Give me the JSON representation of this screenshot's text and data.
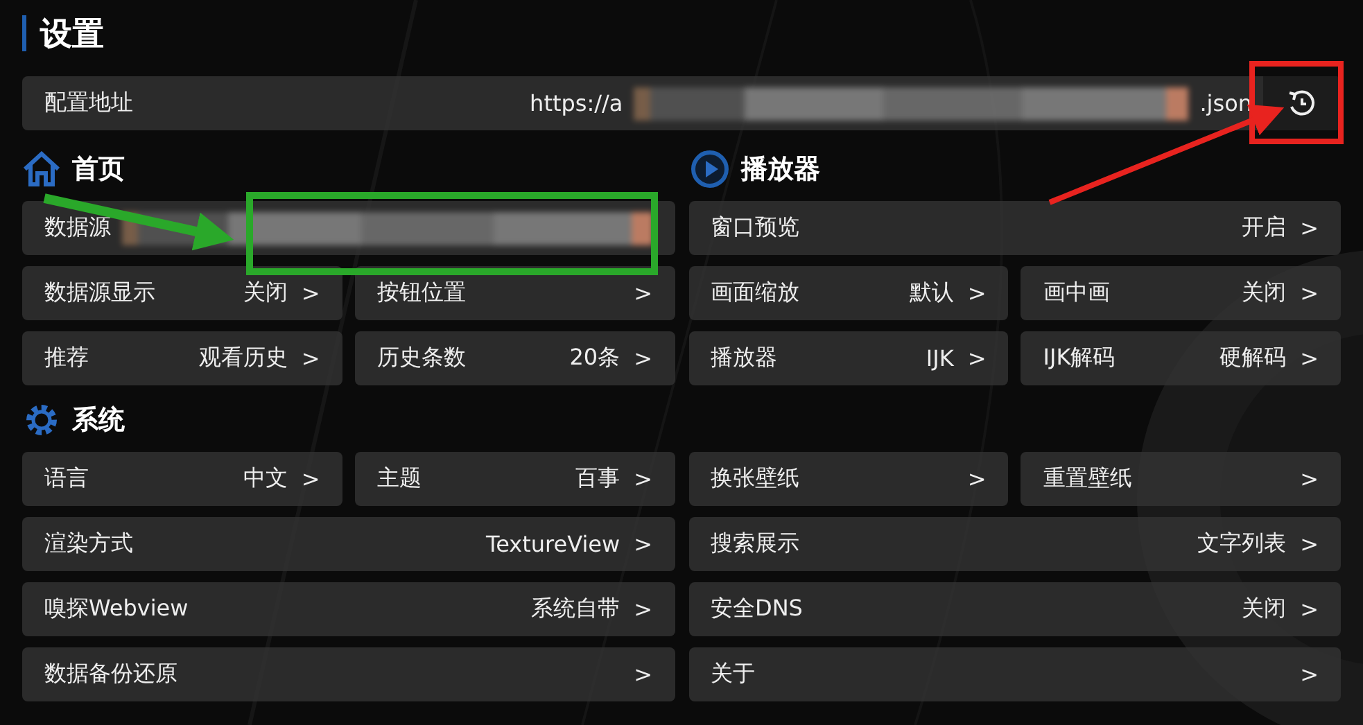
{
  "title": "设置",
  "config": {
    "label": "配置地址",
    "value_start": "https://a",
    "value_end": ".json"
  },
  "left_column": [
    {
      "title": "首页",
      "kind": "home",
      "rows": [
        [
          {
            "label": "数据源",
            "kind": "blurred"
          }
        ],
        [
          {
            "label": "数据源显示",
            "value": "关闭",
            "chevron": ">"
          },
          {
            "label": "按钮位置",
            "chevron": ">"
          }
        ],
        [
          {
            "label": "推荐",
            "value": "观看历史",
            "chevron": ">"
          },
          {
            "label": "历史条数",
            "value": "20条",
            "chevron": ">"
          }
        ]
      ]
    },
    {
      "title": "系统",
      "kind": "gear",
      "rows": [
        [
          {
            "label": "语言",
            "value": "中文",
            "chevron": ">"
          },
          {
            "label": "主题",
            "value": "百事",
            "chevron": ">"
          }
        ],
        [
          {
            "label": "渲染方式",
            "value": "TextureView",
            "chevron": ">"
          }
        ],
        [
          {
            "label": "嗅探Webview",
            "value": "系统自带",
            "chevron": ">"
          }
        ],
        [
          {
            "label": "数据备份还原",
            "chevron": ">"
          }
        ]
      ]
    }
  ],
  "right_column": [
    {
      "title": "播放器",
      "kind": "play",
      "rows": [
        [
          {
            "label": "窗口预览",
            "value": "开启",
            "chevron": ">"
          }
        ],
        [
          {
            "label": "画面缩放",
            "value": "默认",
            "chevron": ">"
          },
          {
            "label": "画中画",
            "value": "关闭",
            "chevron": ">"
          }
        ],
        [
          {
            "label": "播放器",
            "value": "IJK",
            "chevron": ">"
          },
          {
            "label": "IJK解码",
            "value": "硬解码",
            "chevron": ">"
          }
        ]
      ]
    },
    {
      "rows": [
        [
          {
            "label": "换张壁纸",
            "chevron": ">"
          },
          {
            "label": "重置壁纸",
            "chevron": ">"
          }
        ],
        [
          {
            "label": "搜索展示",
            "value": "文字列表",
            "chevron": ">"
          }
        ],
        [
          {
            "label": "安全DNS",
            "value": "关闭",
            "chevron": ">"
          }
        ],
        [
          {
            "label": "关于",
            "chevron": ">"
          }
        ]
      ]
    }
  ]
}
